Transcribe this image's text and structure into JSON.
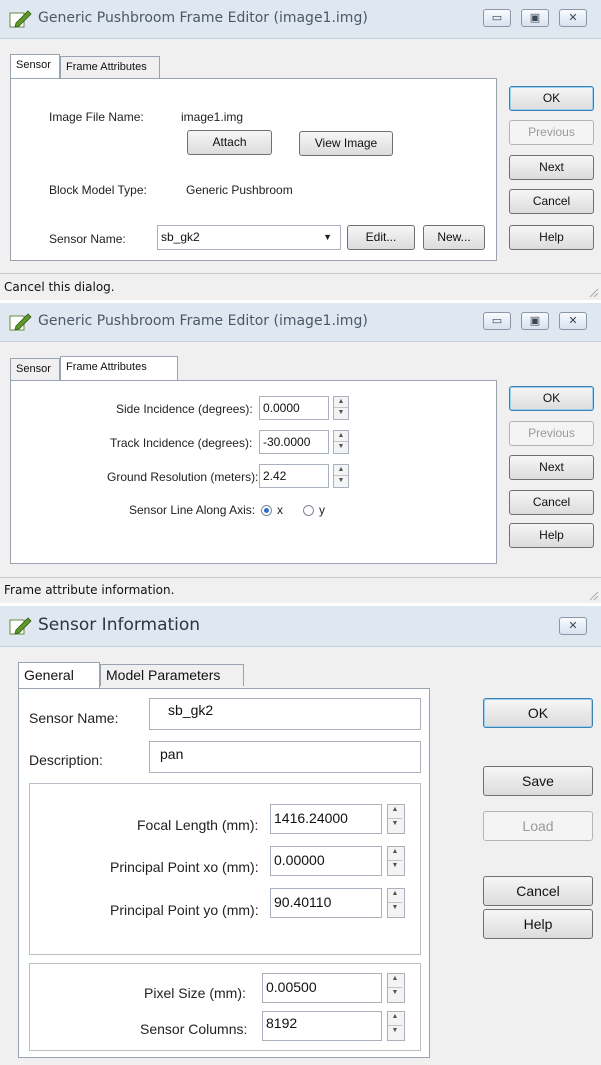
{
  "dialog1": {
    "title": "Generic Pushbroom Frame Editor (image1.img)",
    "tabs": [
      "Sensor",
      "Frame Attributes"
    ],
    "active_tab": "Sensor",
    "image_file_label": "Image File Name:",
    "image_file_value": "image1.img",
    "attach_label": "Attach",
    "view_image_label": "View Image",
    "block_model_label": "Block Model Type:",
    "block_model_value": "Generic Pushbroom",
    "sensor_name_label": "Sensor Name:",
    "sensor_name_value": "sb_gk2",
    "edit_label": "Edit...",
    "new_label": "New...",
    "buttons": {
      "ok": "OK",
      "previous": "Previous",
      "next": "Next",
      "cancel": "Cancel",
      "help": "Help"
    },
    "status": "Cancel this dialog."
  },
  "dialog2": {
    "title": "Generic Pushbroom Frame Editor (image1.img)",
    "tabs": [
      "Sensor",
      "Frame Attributes"
    ],
    "active_tab": "Frame Attributes",
    "side_incidence_label": "Side Incidence (degrees):",
    "side_incidence_value": "0.0000",
    "track_incidence_label": "Track Incidence (degrees):",
    "track_incidence_value": "-30.0000",
    "ground_res_label": "Ground Resolution (meters):",
    "ground_res_value": "2.42",
    "sensor_line_label": "Sensor Line Along Axis:",
    "axis_options": [
      "x",
      "y"
    ],
    "axis_selected": "x",
    "buttons": {
      "ok": "OK",
      "previous": "Previous",
      "next": "Next",
      "cancel": "Cancel",
      "help": "Help"
    },
    "status": "Frame attribute information."
  },
  "dialog3": {
    "title": "Sensor Information",
    "tabs": [
      "General",
      "Model Parameters"
    ],
    "active_tab": "General",
    "sensor_name_label": "Sensor Name:",
    "sensor_name_value": "sb_gk2",
    "description_label": "Description:",
    "description_value": "pan",
    "focal_length_label": "Focal Length (mm):",
    "focal_length_value": "1416.24000",
    "pp_xo_label": "Principal Point xo (mm):",
    "pp_xo_value": "0.00000",
    "pp_yo_label": "Principal Point yo (mm):",
    "pp_yo_value": "90.40110",
    "pixel_size_label": "Pixel Size (mm):",
    "pixel_size_value": "0.00500",
    "sensor_columns_label": "Sensor Columns:",
    "sensor_columns_value": "8192",
    "buttons": {
      "ok": "OK",
      "save": "Save",
      "load": "Load",
      "cancel": "Cancel",
      "help": "Help"
    }
  },
  "icons": {
    "app_icon": "edit-pencil-icon",
    "minimize": "minimize-icon",
    "maximize": "maximize-icon",
    "close": "close-icon"
  },
  "colors": {
    "titlebar": "#dfe7f1",
    "dialog_bg": "#f0f0f0",
    "default_button_border": "#3c7fb1",
    "radio_selected": "#2a6fc9"
  }
}
